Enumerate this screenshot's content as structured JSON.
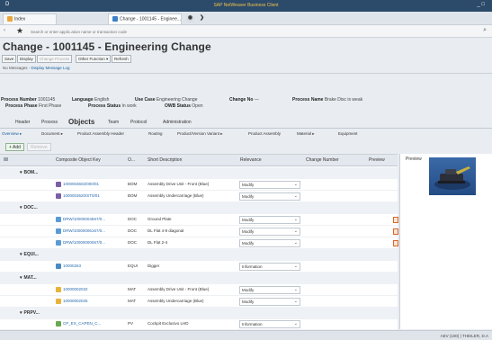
{
  "window": {
    "title": "SAP NetWeaver Business Client",
    "left_icon": "D",
    "right_controls": "_ □"
  },
  "browser_tabs": [
    {
      "label": "Index",
      "active": false
    },
    {
      "label": "Change - 1001145 - Enginee...",
      "active": true
    }
  ],
  "address_bar": {
    "placeholder": "Search or enter applic.ation name or transaction code"
  },
  "page": {
    "title": "Change - 1001145 - Engineering Change"
  },
  "toolbar": {
    "buttons": [
      "Save",
      "Display",
      "Change Process",
      "Other Function ▾",
      "Refresh"
    ],
    "disabled": [
      false,
      false,
      true,
      false,
      false
    ],
    "message_log_prefix": "No Messages",
    "message_log_link": "Display Message Log"
  },
  "header_info": {
    "process_number_label": "Process Number",
    "process_number": "1001145",
    "language_label": "Language",
    "language": "English",
    "use_case_label": "Use Case",
    "use_case": "Engineering Change",
    "change_no_label": "Change No",
    "change_no": "—",
    "process_name_label": "Process Name",
    "process_name": "Brake Disc is weak",
    "process_phase_label": "Process Phase",
    "process_phase": "First Phase",
    "process_status_label": "Process Status",
    "process_status": "In work",
    "owb_status_label": "OWB Status",
    "owb_status": "Open"
  },
  "section_tabs": [
    "Header",
    "Process",
    "Objects",
    "Team",
    "Protocol",
    "Administration"
  ],
  "sub_tabs": [
    "Overview ▸",
    "Document ▸",
    "Product Assembly Header",
    "Routing",
    "Product/Version Variant ▸",
    "Product Assembly",
    "Material ▸",
    "Equipment"
  ],
  "grid_toolbar": {
    "add": "Add",
    "remove": "Remove"
  },
  "grid": {
    "columns": [
      "Composite Object Key",
      "O...",
      "Short Description",
      "Relevance",
      "Change Number",
      "Preview"
    ],
    "groups": [
      {
        "label": "BOM...",
        "rows": [
          {
            "key": "1000003602/000/01",
            "type": "BOM",
            "desc": "Assembly Drive Unit - Front (Blue)",
            "relevance": "Modify",
            "pdf": false
          },
          {
            "key": "1000003620/ST0/01",
            "type": "BOM",
            "desc": "Assembly Undercarriage (Blue)",
            "relevance": "Modify",
            "pdf": false
          }
        ]
      },
      {
        "label": "DOC...",
        "rows": [
          {
            "key": "DRW/10000004667/0...",
            "type": "DOC",
            "desc": "Ground Plate",
            "relevance": "Modify",
            "pdf": true
          },
          {
            "key": "DRW/10000006167/0...",
            "type": "DOC",
            "desc": "DL Flat 4-9 diagonal",
            "relevance": "Modify",
            "pdf": true
          },
          {
            "key": "DRW/10000000067/0...",
            "type": "DOC",
            "desc": "DL Flat 2-4",
            "relevance": "Modify",
            "pdf": true
          }
        ]
      },
      {
        "label": "EQUI...",
        "rows": [
          {
            "key": "10000263",
            "type": "EQUI",
            "desc": "Digger",
            "relevance": "Information",
            "pdf": false
          }
        ]
      },
      {
        "label": "MAT...",
        "rows": [
          {
            "key": "10000002032",
            "type": "MAT",
            "desc": "Assembly Drive Unit - Front (Blue)",
            "relevance": "Modify",
            "pdf": false
          },
          {
            "key": "10000002025",
            "type": "MAT",
            "desc": "Assembly Undercarriage (Blue)",
            "relevance": "Modify",
            "pdf": false
          }
        ]
      },
      {
        "label": "PRPV...",
        "rows": [
          {
            "key": "CP_EX_CAPEN_C...",
            "type": "PV",
            "desc": "Cockpit Exclusivo LHD",
            "relevance": "Information",
            "pdf": false
          }
        ]
      }
    ]
  },
  "preview": {
    "title": "Preview"
  },
  "status_bar": {
    "text": "AEV (100) | THEILER, D.A"
  },
  "colors": {
    "accent": "#2c4a6a",
    "link": "#2a6bb0",
    "title_amber": "#f0c24a"
  },
  "icons": {
    "bom": "bom-icon",
    "doc": "document-icon",
    "equi": "equipment-icon",
    "mat": "material-icon",
    "pv": "product-version-icon",
    "pdf": "pdf-icon"
  }
}
